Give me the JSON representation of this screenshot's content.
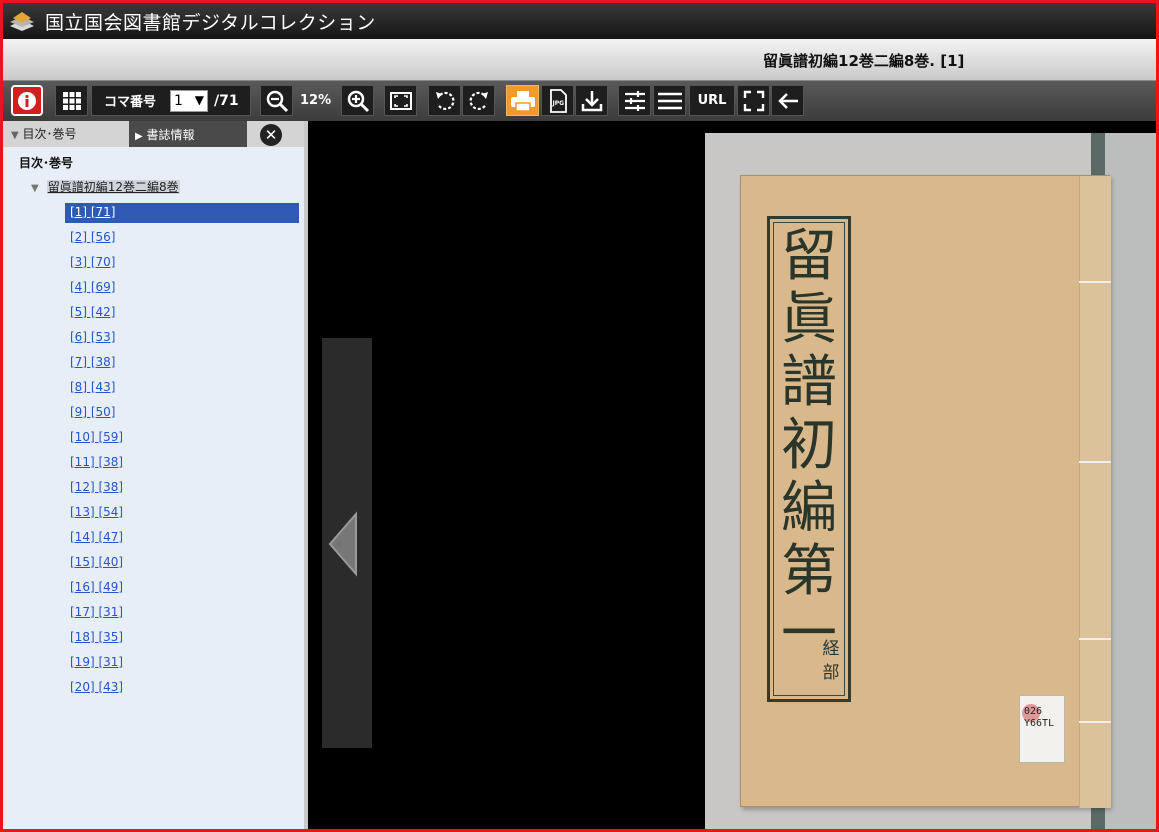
{
  "app": {
    "title": "国立国会図書館デジタルコレクション"
  },
  "book": {
    "title": "留眞譜初編12巻二編8巻. [1]"
  },
  "toolbar": {
    "frame_label": "コマ番号",
    "frame_value": "1",
    "frame_total": "/71",
    "zoom": "12%",
    "url_label": "URL",
    "colors": {
      "active": "#f29a2e",
      "info": "#d21f1f"
    }
  },
  "sidebar": {
    "tab_toc": "目次･巻号",
    "tab_biblio": "書誌情報",
    "close_icon": "close-icon",
    "toc_heading": "目次･巻号",
    "book_node": "留眞譜初編12巻二編8巻",
    "items": [
      {
        "label": "[1] [71]",
        "selected": true
      },
      {
        "label": "[2] [56]"
      },
      {
        "label": "[3] [70]"
      },
      {
        "label": "[4] [69]"
      },
      {
        "label": "[5] [42]"
      },
      {
        "label": "[6] [53]"
      },
      {
        "label": "[7] [38]"
      },
      {
        "label": "[8] [43]"
      },
      {
        "label": "[9] [50]"
      },
      {
        "label": "[10] [59]"
      },
      {
        "label": "[11] [38]"
      },
      {
        "label": "[12] [38]"
      },
      {
        "label": "[13] [54]"
      },
      {
        "label": "[14] [47]"
      },
      {
        "label": "[15] [40]"
      },
      {
        "label": "[16] [49]"
      },
      {
        "label": "[17] [31]"
      },
      {
        "label": "[18] [35]"
      },
      {
        "label": "[19] [31]"
      },
      {
        "label": "[20] [43]"
      }
    ]
  },
  "cover": {
    "title_chars": [
      "留",
      "眞",
      "譜",
      "初",
      "編",
      "第",
      "一"
    ],
    "sub_label": "経部",
    "sticker": "026\nY66TL"
  }
}
